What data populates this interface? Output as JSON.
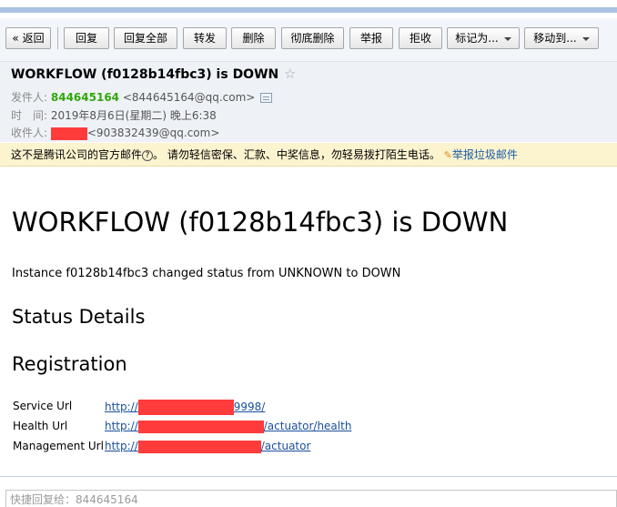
{
  "toolbar": {
    "back": "« 返回",
    "reply": "回复",
    "reply_all": "回复全部",
    "forward": "转发",
    "delete": "删除",
    "delete_permanently": "彻底删除",
    "report": "举报",
    "reject": "拒收",
    "mark_as": "标记为...",
    "move_to": "移动到..."
  },
  "header": {
    "subject": "WORKFLOW (f0128b14fbc3) is DOWN",
    "star": "☆",
    "from_label": "发件人:",
    "from_name": "844645164",
    "from_email": "<844645164@qq.com>",
    "time_label": "时　间:",
    "time_value": "2019年8月6日(星期二) 晚上6:38",
    "to_label": "收件人:",
    "to_email": "<903832439@qq.com>"
  },
  "notice": {
    "text_before": "这不是腾讯公司的官方邮件",
    "question": "?",
    "text_after": "。 请勿轻信密保、汇款、中奖信息，勿轻易拨打陌生电话。",
    "report_link": "举报垃圾邮件"
  },
  "email_body": {
    "heading": "WORKFLOW (f0128b14fbc3) is DOWN",
    "paragraph": "Instance f0128b14fbc3 changed status from UNKNOWN to DOWN",
    "status_details": "Status Details",
    "registration": "Registration",
    "service_url_label": "Service Url",
    "service_url_prefix": "http://",
    "service_url_suffix": "9998/",
    "health_url_label": "Health Url",
    "health_url_prefix": "http://",
    "health_url_suffix": "/actuator/health",
    "management_url_label": "Management Url",
    "management_url_prefix": "http://",
    "management_url_suffix": "/actuator"
  },
  "reply": {
    "placeholder": "快捷回复给：844645164"
  },
  "colors": {
    "redaction": "#ff3b3b",
    "sender_green": "#31a80a",
    "link_blue": "#1a4f9c",
    "notice_bg": "#fcf3cf"
  }
}
